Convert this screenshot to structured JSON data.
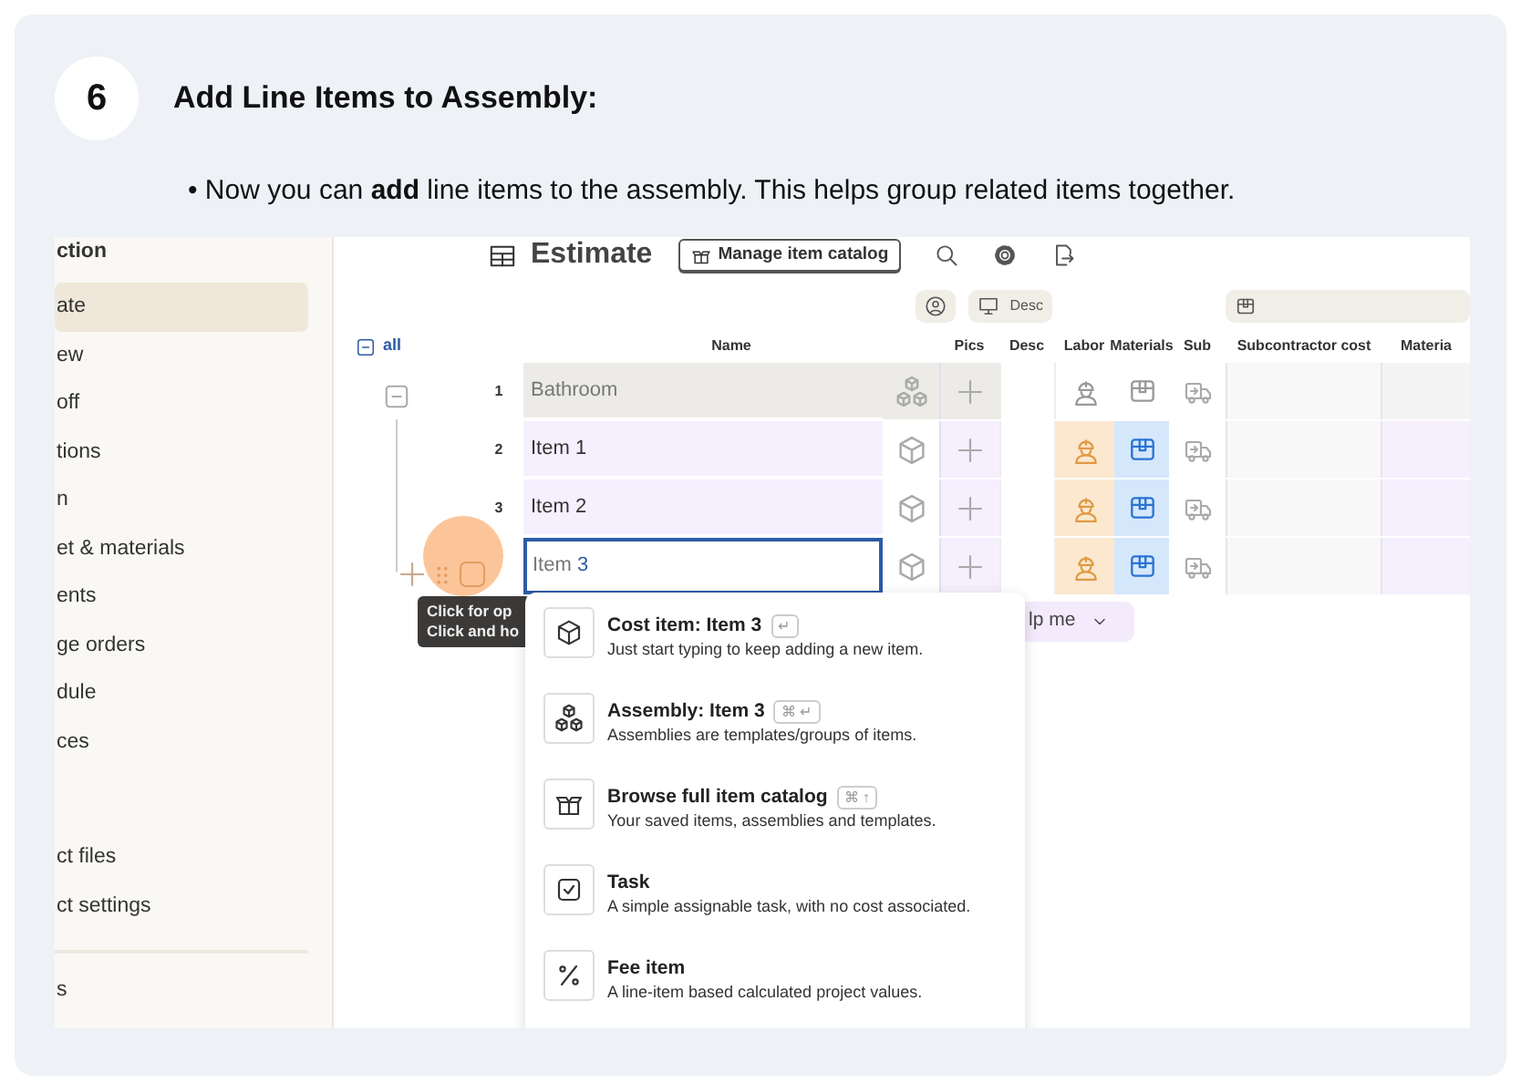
{
  "step": {
    "number": "6",
    "title": "Add Line Items to Assembly:"
  },
  "instruction": "• Now you can **add** line items to the assembly. This helps group related items together.",
  "app": {
    "sidebar": {
      "heading": "ction",
      "items": [
        {
          "label": "ate",
          "selected": true
        },
        {
          "label": "ew",
          "selected": false
        },
        {
          "label": "off",
          "selected": false
        },
        {
          "label": "tions",
          "selected": false
        },
        {
          "label": "n",
          "selected": false
        },
        {
          "label": "et & materials",
          "selected": false
        },
        {
          "label": "ents",
          "selected": false
        },
        {
          "label": "ge orders",
          "selected": false
        },
        {
          "label": "dule",
          "selected": false
        },
        {
          "label": "ces",
          "selected": false
        }
      ],
      "project_items": [
        {
          "label": "ct files",
          "selected": false
        },
        {
          "label": "ct settings",
          "selected": false
        }
      ],
      "footer_items": [
        {
          "label": "s",
          "selected": false
        }
      ]
    },
    "toolbar": {
      "title": "Estimate",
      "catalog_button": "Manage item catalog"
    },
    "column_chips": [
      {
        "kind": "person"
      },
      {
        "kind": "screen",
        "label": "Desc"
      },
      {
        "kind": "box"
      }
    ],
    "tree": {
      "toggle_label": "all"
    },
    "table": {
      "columns": [
        "Name",
        "Pics",
        "Desc",
        "Labor",
        "Materials",
        "Sub",
        "Subcontractor cost",
        "Materia"
      ],
      "rows": [
        {
          "number": "1",
          "kind": "assembly",
          "name": "Bathroom",
          "editing": false,
          "labor": false,
          "materials": false,
          "sub": false
        },
        {
          "number": "2",
          "kind": "item",
          "name": "Item 1",
          "editing": false,
          "labor": true,
          "materials": true,
          "sub": false
        },
        {
          "number": "3",
          "kind": "item",
          "name": "Item 2",
          "editing": false,
          "labor": true,
          "materials": true,
          "sub": false
        },
        {
          "kind": "item",
          "name": "Item",
          "typed": "3",
          "editing": true,
          "labor": true,
          "materials": true,
          "sub": false
        }
      ]
    },
    "tooltip": {
      "lines": [
        "Click for op",
        "Click and ho"
      ]
    },
    "help_button": {
      "label": "lp me"
    },
    "menu": [
      {
        "kind": "cost",
        "title": "Cost item: Item 3",
        "shortcut": "↵",
        "description": "Just start typing to keep adding a new item."
      },
      {
        "kind": "assembly",
        "title": "Assembly: Item 3",
        "shortcut": "⌘ ↵",
        "description": "Assemblies are templates/groups of items."
      },
      {
        "kind": "catalog",
        "title": "Browse full item catalog",
        "shortcut": "⌘ ↑",
        "description": "Your saved items, assemblies and templates."
      },
      {
        "kind": "task",
        "title": "Task",
        "description": "A simple assignable task, with no cost associated."
      },
      {
        "kind": "fee",
        "title": "Fee item",
        "description": "A line-item based calculated project values."
      }
    ]
  }
}
